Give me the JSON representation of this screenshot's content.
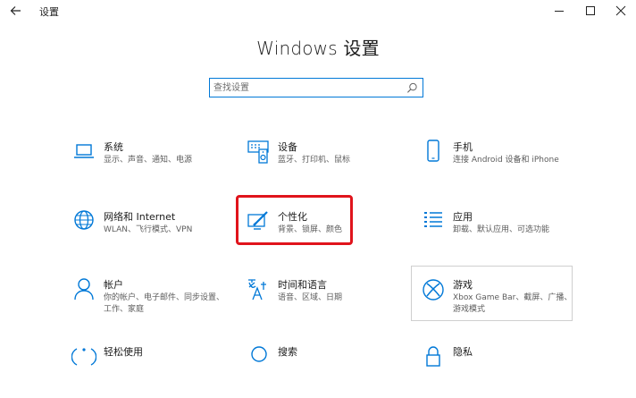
{
  "window": {
    "app_title": "设置",
    "back_icon": "back-arrow-icon",
    "controls": [
      "minimize-icon",
      "maximize-icon",
      "close-icon"
    ]
  },
  "page": {
    "title": "Windows 设置"
  },
  "search": {
    "placeholder": "查找设置",
    "icon": "search-icon"
  },
  "accent_color": "#0078d7",
  "highlight_color": "#e0141c",
  "tiles": [
    {
      "name": "系统",
      "desc": "显示、声音、通知、电源",
      "icon": "laptop-icon"
    },
    {
      "name": "设备",
      "desc": "蓝牙、打印机、鼠标",
      "icon": "keyboard-speaker-icon"
    },
    {
      "name": "手机",
      "desc": "连接 Android 设备和 iPhone",
      "icon": "phone-icon"
    },
    {
      "name": "网络和 Internet",
      "desc": "WLAN、飞行模式、VPN",
      "icon": "globe-icon"
    },
    {
      "name": "个性化",
      "desc": "背景、锁屏、颜色",
      "icon": "paint-brush-icon"
    },
    {
      "name": "应用",
      "desc": "卸载、默认应用、可选功能",
      "icon": "apps-list-icon"
    },
    {
      "name": "帐户",
      "desc": "你的帐户、电子邮件、同步设置、工作、家庭",
      "icon": "person-icon"
    },
    {
      "name": "时间和语言",
      "desc": "语音、区域、日期",
      "icon": "time-language-icon"
    },
    {
      "name": "游戏",
      "desc": "Xbox Game Bar、截屏、广播、游戏模式",
      "icon": "xbox-icon"
    },
    {
      "name": "轻松使用",
      "desc": "",
      "icon": "ease-of-access-icon"
    },
    {
      "name": "搜索",
      "desc": "",
      "icon": "search-icon"
    },
    {
      "name": "隐私",
      "desc": "",
      "icon": "lock-icon"
    }
  ]
}
